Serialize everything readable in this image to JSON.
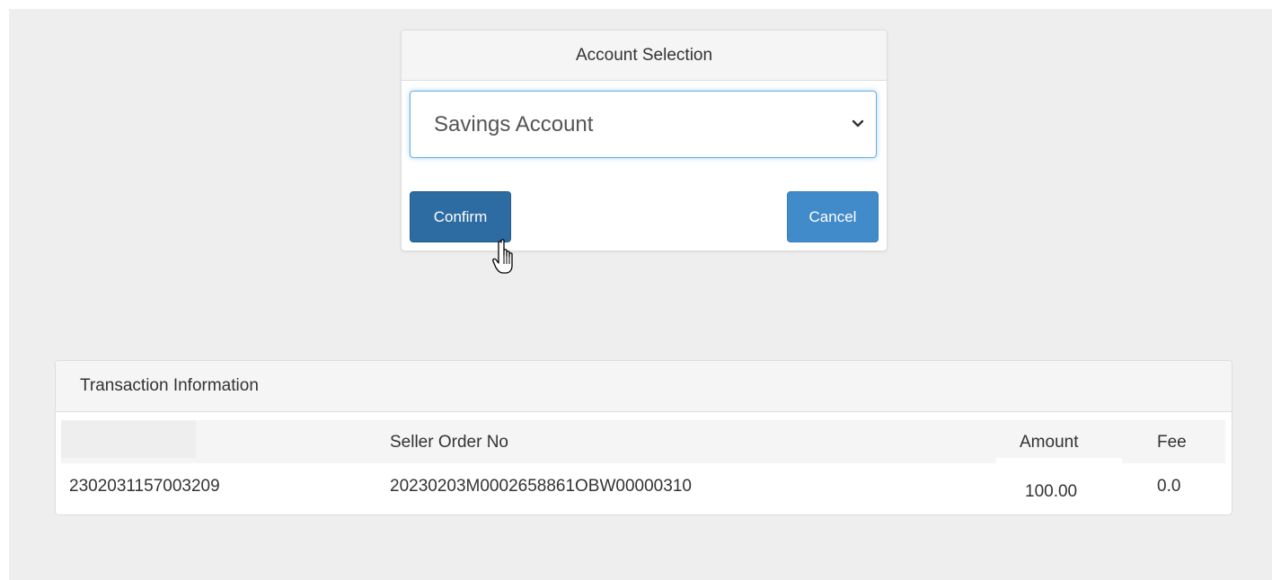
{
  "account_selection": {
    "title": "Account Selection",
    "selected_account": "Savings Account",
    "confirm_label": "Confirm",
    "cancel_label": "Cancel"
  },
  "transaction_info": {
    "title": "Transaction Information",
    "columns": [
      "",
      "Seller Order No",
      "Amount",
      "Fee"
    ],
    "rows": [
      [
        "2302031157003209",
        "20230203M0002658861OBW00000310",
        "100.00",
        "0.0"
      ]
    ]
  },
  "colors": {
    "primary_button": "#428bca",
    "pressed_button": "#2d6ca2",
    "focus_border": "#66afe9",
    "page_background": "#eeeeee"
  },
  "icons": [
    "chevron-down-icon",
    "hand-pointer-icon"
  ]
}
